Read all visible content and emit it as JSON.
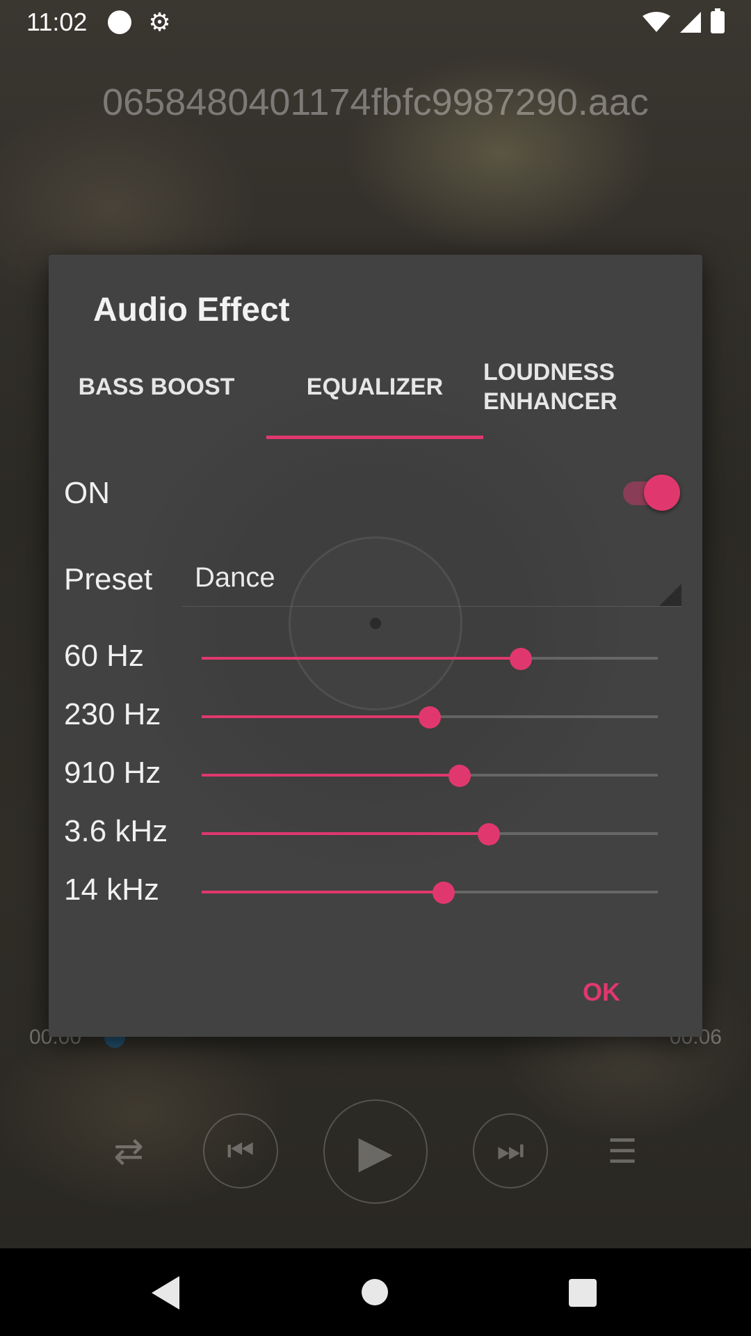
{
  "status_bar": {
    "time": "11:02"
  },
  "player": {
    "track_title": "0658480401174fbfc9987290.aac",
    "time_elapsed": "00:00",
    "time_total": "00:06",
    "progress": 0.0
  },
  "dialog": {
    "title": "Audio Effect",
    "tabs": [
      {
        "label": "BASS BOOST",
        "selected": false
      },
      {
        "label": "EQUALIZER",
        "selected": true
      },
      {
        "label": "LOUDNESS ENHANCER",
        "selected": false
      }
    ],
    "enabled_label": "ON",
    "enabled": true,
    "preset_label": "Preset",
    "preset_value": "Dance",
    "bands": [
      {
        "label": "60 Hz",
        "level": 0.7
      },
      {
        "label": "230 Hz",
        "level": 0.5
      },
      {
        "label": "910 Hz",
        "level": 0.565
      },
      {
        "label": "3.6 kHz",
        "level": 0.63
      },
      {
        "label": "14 kHz",
        "level": 0.53
      }
    ],
    "ok_label": "OK"
  },
  "colors": {
    "accent": "#e0386e",
    "dialog_bg": "#424242",
    "nav_bar": "#000000"
  },
  "icons": {
    "status": [
      "notification-dot-icon",
      "settings-gear-icon",
      "wifi-icon",
      "signal-icon",
      "battery-icon"
    ],
    "controls": [
      "shuffle-icon",
      "skip-previous-icon",
      "play-icon",
      "skip-next-icon",
      "equalizer-icon"
    ],
    "navigation": [
      "back-icon",
      "home-icon",
      "recents-icon"
    ]
  }
}
